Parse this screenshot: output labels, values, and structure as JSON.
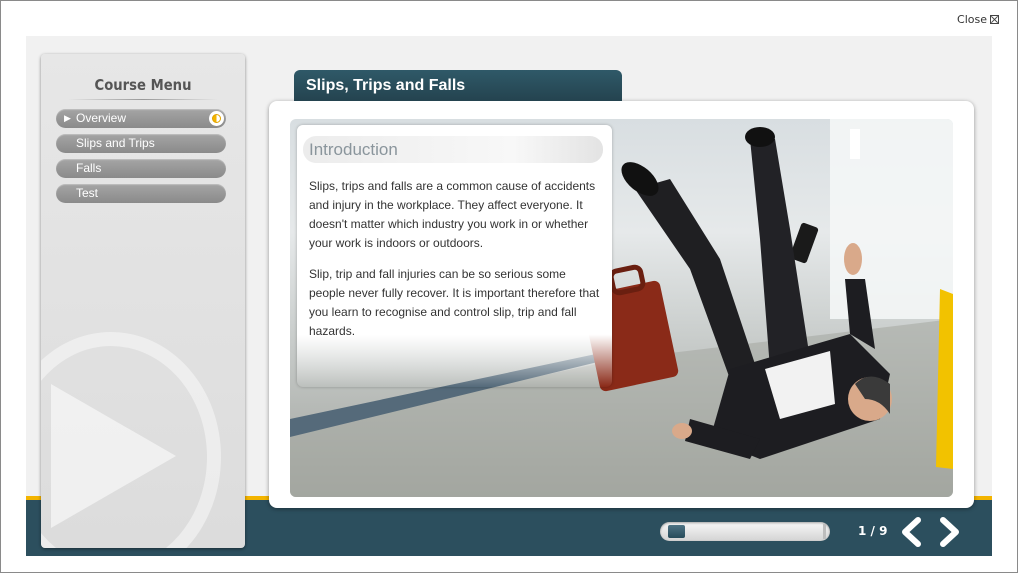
{
  "window": {
    "close_label": "Close"
  },
  "menu": {
    "title": "Course Menu",
    "items": [
      {
        "label": "Overview",
        "current": true
      },
      {
        "label": "Slips and Trips"
      },
      {
        "label": "Falls"
      },
      {
        "label": "Test"
      }
    ]
  },
  "module": {
    "title": "Slips, Trips and Falls"
  },
  "content": {
    "heading": "Introduction",
    "paragraphs": [
      "Slips, trips and falls are a common cause of accidents and injury in the workplace. They affect everyone. It doesn't matter which industry you work in or whether your work is indoors or outdoors.",
      "Slip, trip and fall injuries can be so serious some people never fully recover. It is important therefore that you learn to recognise and control slip, trip and fall hazards."
    ]
  },
  "footer": {
    "page_label": "1 / 9",
    "progress_fraction": 0.11
  },
  "colors": {
    "accent": "#f3b400",
    "brand_dark": "#2c4f5e"
  },
  "icons": {
    "play_watermark": "play-icon",
    "prev": "chevron-left-icon",
    "next": "chevron-right-icon",
    "close": "close-icon"
  }
}
